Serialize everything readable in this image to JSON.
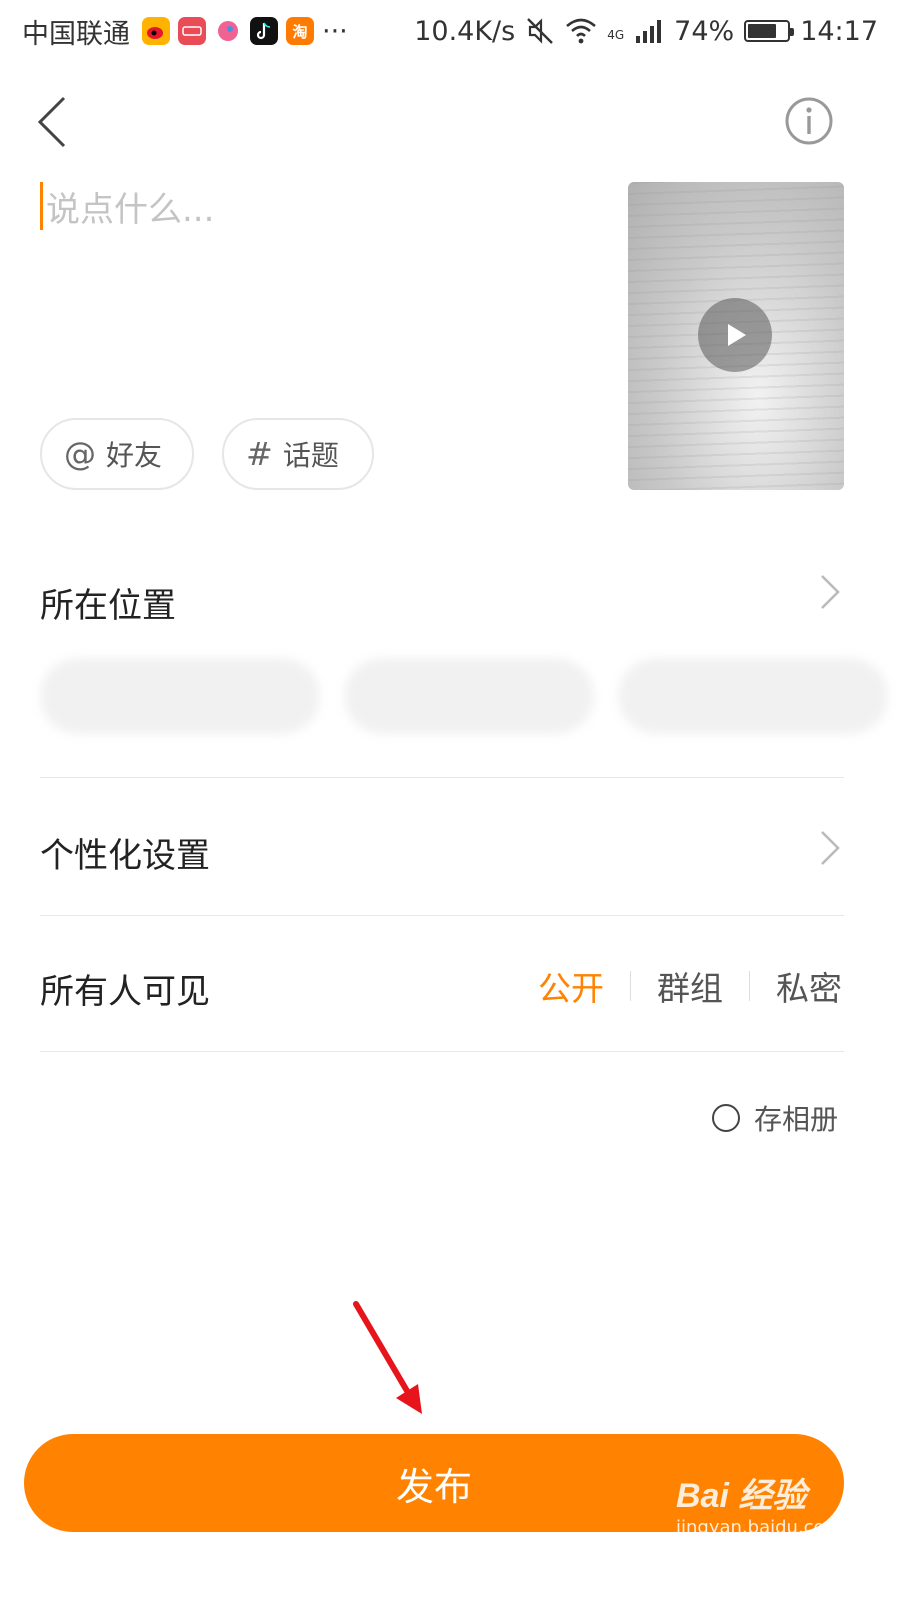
{
  "status_bar": {
    "carrier": "中国联通",
    "app_icons": [
      "weibo-icon",
      "news-app-icon",
      "bird-app-icon",
      "tiktok-icon",
      "taobao-icon"
    ],
    "taobao_label": "淘",
    "more": "···",
    "speed": "10.4K/s",
    "network": "4G",
    "battery": "74%",
    "battery_level": 0.74,
    "time": "14:17"
  },
  "compose": {
    "placeholder": "说点什么..."
  },
  "chips": {
    "friend_label": "好友",
    "friend_icon": "@",
    "topic_label": "话题",
    "topic_icon": "#"
  },
  "location": {
    "title": "所在位置",
    "suggestions": [
      "",
      "",
      ""
    ]
  },
  "personalize": {
    "title": "个性化设置"
  },
  "visibility": {
    "title": "所有人可见",
    "options": [
      "公开",
      "群组",
      "私密"
    ],
    "selected": "公开"
  },
  "save_album_label": "存相册",
  "publish_label": "发布",
  "watermark": {
    "main": "Bai 经验",
    "sub": "jingyan.baidu.com"
  },
  "colors": {
    "accent": "#ff8200",
    "annotation_arrow": "#e8141b"
  }
}
